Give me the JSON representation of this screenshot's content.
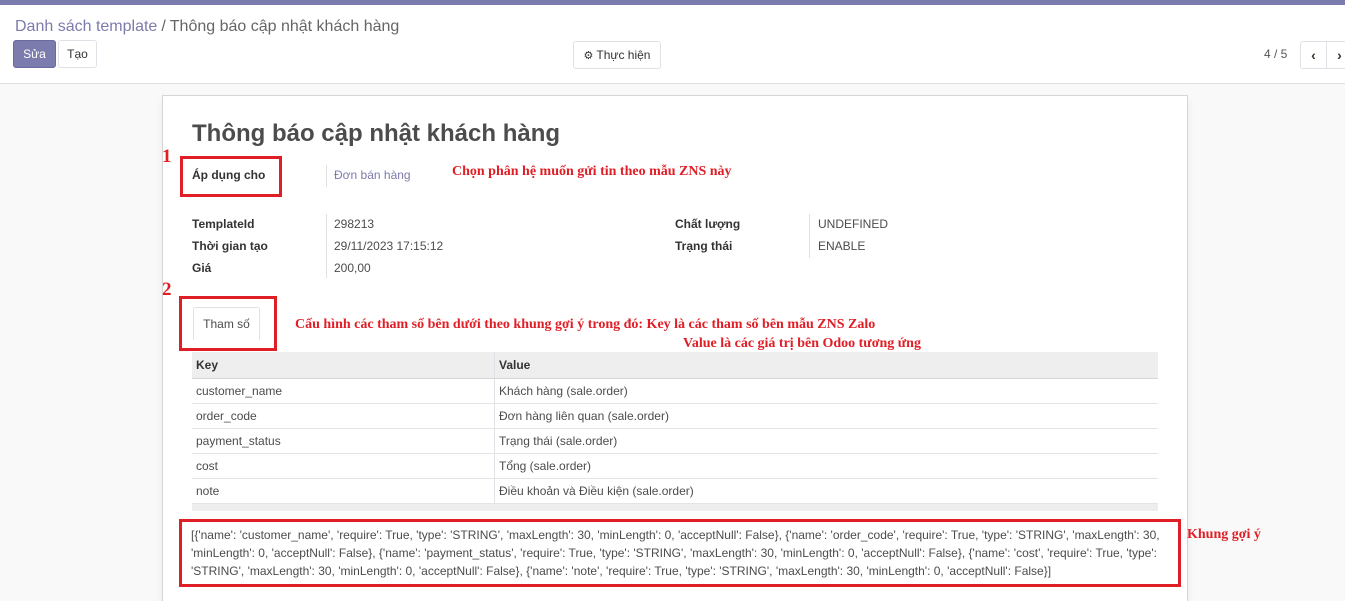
{
  "breadcrumb": {
    "parent": "Danh sách template",
    "separator": "/",
    "current": "Thông báo cập nhật khách hàng"
  },
  "toolbar": {
    "edit_label": "Sửa",
    "create_label": "Tạo",
    "action_label": "Thực hiện",
    "action_icon": "gear-icon",
    "pager_text": "4 / 5",
    "prev_icon": "‹",
    "next_icon": "›"
  },
  "form": {
    "title": "Thông báo cập nhật khách hàng",
    "apply_to_label": "Áp dụng cho",
    "apply_to_value": "Đơn bán hàng",
    "template_id_label": "TemplateId",
    "template_id_value": "298213",
    "created_label": "Thời gian tạo",
    "created_value": "29/11/2023 17:15:12",
    "price_label": "Giá",
    "price_value": "200,00",
    "quality_label": "Chất lượng",
    "quality_value": "UNDEFINED",
    "status_label": "Trạng thái",
    "status_value": "ENABLE",
    "tab_label": "Tham số"
  },
  "params_table": {
    "headers": {
      "key": "Key",
      "value": "Value"
    },
    "rows": [
      {
        "key": "customer_name",
        "value": "Khách hàng (sale.order)"
      },
      {
        "key": "order_code",
        "value": "Đơn hàng liên quan (sale.order)"
      },
      {
        "key": "payment_status",
        "value": "Trạng thái (sale.order)"
      },
      {
        "key": "cost",
        "value": "Tổng (sale.order)"
      },
      {
        "key": "note",
        "value": "Điều khoản và Điều kiện (sale.order)"
      }
    ]
  },
  "hint_text": "[{'name': 'customer_name', 'require': True, 'type': 'STRING', 'maxLength': 30, 'minLength': 0, 'acceptNull': False}, {'name': 'order_code', 'require': True, 'type': 'STRING', 'maxLength': 30, 'minLength': 0, 'acceptNull': False}, {'name': 'payment_status', 'require': True, 'type': 'STRING', 'maxLength': 30, 'minLength': 0, 'acceptNull': False}, {'name': 'cost', 'require': True, 'type': 'STRING', 'maxLength': 30, 'minLength': 0, 'acceptNull': False}, {'name': 'note', 'require': True, 'type': 'STRING', 'maxLength': 30, 'minLength': 0, 'acceptNull': False}]",
  "annotations": {
    "num1": "1",
    "num2": "2",
    "note1": "Chọn phân hệ muốn gửi tin theo mẫu ZNS này",
    "note2_line1": "Cấu hình các tham số bên dưới theo khung gợi ý  trong đó: Key là các tham số bên mẫu ZNS Zalo",
    "note2_line2": "Value là các giá trị bên Odoo tương ứng",
    "note3": "Khung gợi ý",
    "annotation_color": "#e01e26"
  },
  "colors": {
    "brand": "#7c7bad"
  }
}
